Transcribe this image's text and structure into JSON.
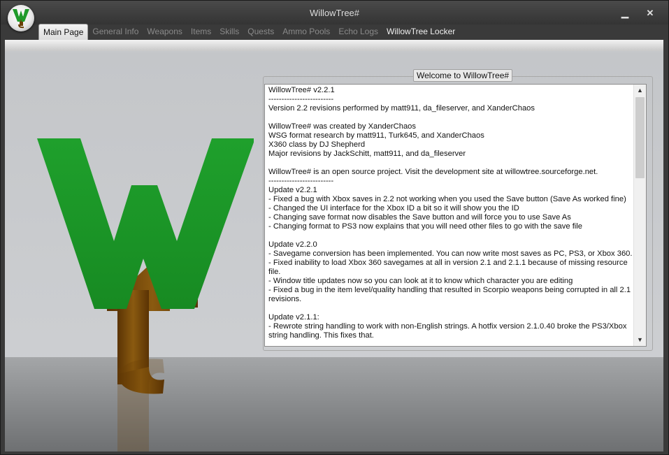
{
  "window": {
    "title": "WillowTree#",
    "minimize_label": "▁",
    "close_label": "✕"
  },
  "tabs": [
    {
      "label": "Main Page",
      "state": "active"
    },
    {
      "label": "General Info",
      "state": "disabled"
    },
    {
      "label": "Weapons",
      "state": "disabled"
    },
    {
      "label": "Items",
      "state": "disabled"
    },
    {
      "label": "Skills",
      "state": "disabled"
    },
    {
      "label": "Quests",
      "state": "disabled"
    },
    {
      "label": "Ammo Pools",
      "state": "disabled"
    },
    {
      "label": "Echo Logs",
      "state": "disabled"
    },
    {
      "label": "WillowTree Locker",
      "state": "enabled"
    }
  ],
  "welcome": {
    "group_label": "Welcome to WillowTree#",
    "lines": [
      "WillowTree# v2.2.1",
      "-------------------------",
      "Version 2.2  revisions performed by matt911, da_fileserver, and XanderChaos",
      "",
      "WillowTree# was created by XanderChaos",
      "WSG format research by matt911, Turk645, and XanderChaos",
      "X360 class by DJ Shepherd",
      "Major revisions by JackSchitt, matt911, and da_fileserver",
      "",
      "WillowTree# is an open source project.  Visit the development site at willowtree.sourceforge.net.",
      "-------------------------",
      "Update v2.2.1",
      "- Fixed a bug with Xbox saves in 2.2 not working when you used the Save button (Save As worked fine)",
      "- Changed the UI interface for the Xbox ID a bit so it will show you the ID",
      "- Changing save format now disables the Save button and will force you to use Save As",
      "- Changing format to PS3 now explains that you will need other files to go with the save file",
      "",
      "Update v2.2.0",
      "- Savegame conversion has been implemented.  You can now write most saves as PC, PS3, or Xbox 360.",
      "- Fixed inability to load Xbox 360 savegames at all in version 2.1 and 2.1.1 because of missing resource file.",
      "- Window title updates now so you can look at it to know which character you are editing",
      "- Fixed a bug in the item level/quality handling that resulted in Scorpio weapons being corrupted in all 2.1 revisions.",
      "",
      "Update v2.1.1:",
      "- Rewrote string handling to work with non-English strings.  A hotfix version 2.1.0.40 broke the PS3/Xbox string handling.  This fixes that."
    ],
    "scroll_up": "▲",
    "scroll_down": "▼"
  },
  "colors": {
    "logo_green": "#1f9a2a",
    "logo_brown": "#6a3f05"
  }
}
